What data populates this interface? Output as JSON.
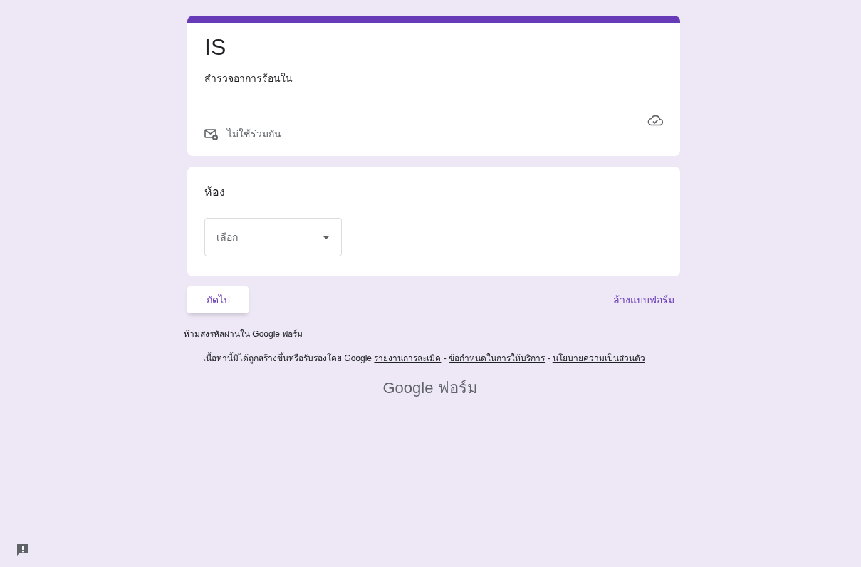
{
  "header": {
    "title": "IS",
    "description": "สำรวจอาการร้อนใน",
    "email_status": "ไม่ใช้ร่วมกัน"
  },
  "question": {
    "label": "ห้อง",
    "dropdown": {
      "placeholder": "เลือก"
    }
  },
  "actions": {
    "next": "ถัดไป",
    "clear": "ล้างแบบฟอร์ม"
  },
  "footer": {
    "warning": "ห้ามส่งรหัสผ่านใน Google ฟอร์ม",
    "disclaimer": "เนื้อหานี้มิได้ถูกสร้างขึ้นหรือรับรองโดย Google",
    "links": [
      {
        "label": "รายงานการละเมิด"
      },
      {
        "label": "ข้อกำหนดในการให้บริการ"
      },
      {
        "label": "นโยบายความเป็นส่วนตัว"
      }
    ],
    "separator": "-",
    "logo": "Google ฟอร์ม"
  }
}
